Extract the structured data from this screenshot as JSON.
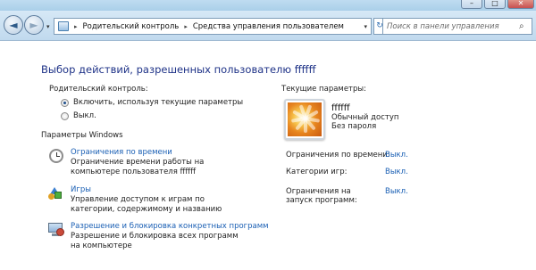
{
  "window": {
    "minimize_glyph": "–",
    "maximize_glyph": "□",
    "close_glyph": "✕"
  },
  "nav": {
    "back_glyph": "◄",
    "forward_glyph": "►",
    "dropdown_glyph": "▾",
    "breadcrumbs": [
      "Родительский контроль",
      "Средства управления пользователем"
    ],
    "separator_glyph": "▸",
    "refresh_glyph": "↻",
    "search_placeholder": "Поиск в панели управления",
    "search_glyph": "⌕"
  },
  "main": {
    "title": "Выбор действий, разрешенных пользователю ffffff",
    "parental_control_label": "Родительский контроль:",
    "options": [
      {
        "label": "Включить, используя текущие параметры",
        "checked": true
      },
      {
        "label": "Выкл.",
        "checked": false
      }
    ],
    "windows_settings_label": "Параметры Windows",
    "settings": [
      {
        "icon": "clock-icon",
        "link": "Ограничения по времени",
        "description": "Ограничение времени работы на компьютере пользователя ffffff"
      },
      {
        "icon": "games-icon",
        "link": "Игры",
        "description": "Управление доступом к играм по категории, содержимому и названию"
      },
      {
        "icon": "programs-block-icon",
        "link": "Разрешение и блокировка конкретных программ",
        "description": "Разрешение и блокировка всех программ на компьютере"
      }
    ]
  },
  "current": {
    "label": "Текущие параметры:",
    "user_name": "ffffff",
    "account_type": "Обычный доступ",
    "password_status": "Без пароля",
    "stats": [
      {
        "label": "Ограничения по времени:",
        "value": "Выкл."
      },
      {
        "label": "Категории игр:",
        "value": "Выкл."
      },
      {
        "label": "Ограничения на запуск программ:",
        "value": "Выкл."
      }
    ]
  }
}
